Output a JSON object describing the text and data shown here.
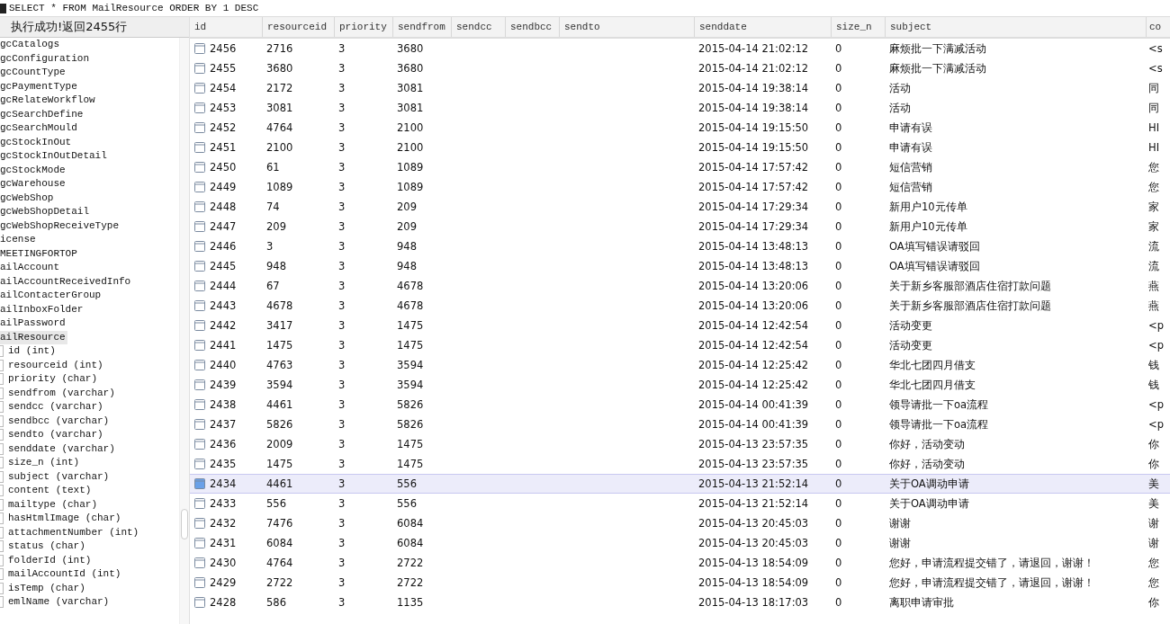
{
  "query_bar": {
    "text": "SELECT * FROM MailResource ORDER BY 1 DESC"
  },
  "sidebar": {
    "status": "执行成功!返回2455行",
    "items": [
      {
        "label": "gcCatalogs",
        "selected": false
      },
      {
        "label": "gcConfiguration",
        "selected": false
      },
      {
        "label": "gcCountType",
        "selected": false
      },
      {
        "label": "gcPaymentType",
        "selected": false
      },
      {
        "label": "gcRelateWorkflow",
        "selected": false
      },
      {
        "label": "gcSearchDefine",
        "selected": false
      },
      {
        "label": "gcSearchMould",
        "selected": false
      },
      {
        "label": "gcStockInOut",
        "selected": false
      },
      {
        "label": "gcStockInOutDetail",
        "selected": false
      },
      {
        "label": "gcStockMode",
        "selected": false
      },
      {
        "label": "gcWarehouse",
        "selected": false
      },
      {
        "label": "gcWebShop",
        "selected": false
      },
      {
        "label": "gcWebShopDetail",
        "selected": false
      },
      {
        "label": "gcWebShopReceiveType",
        "selected": false
      },
      {
        "label": "icense",
        "selected": false
      },
      {
        "label": "MEETINGFORTOP",
        "selected": false
      },
      {
        "label": "ailAccount",
        "selected": false
      },
      {
        "label": "ailAccountReceivedInfo",
        "selected": false
      },
      {
        "label": "ailContacterGroup",
        "selected": false
      },
      {
        "label": "ailInboxFolder",
        "selected": false
      },
      {
        "label": "ailPassword",
        "selected": false
      },
      {
        "label": "ailResource",
        "selected": true,
        "children": [
          {
            "label": "id (int)"
          },
          {
            "label": "resourceid (int)"
          },
          {
            "label": "priority (char)"
          },
          {
            "label": "sendfrom (varchar)"
          },
          {
            "label": "sendcc (varchar)"
          },
          {
            "label": "sendbcc (varchar)"
          },
          {
            "label": "sendto (varchar)"
          },
          {
            "label": "senddate (varchar)"
          },
          {
            "label": "size_n (int)"
          },
          {
            "label": "subject (varchar)"
          },
          {
            "label": "content (text)"
          },
          {
            "label": "mailtype (char)"
          },
          {
            "label": "hasHtmlImage (char)"
          },
          {
            "label": "attachmentNumber (int)"
          },
          {
            "label": "status (char)"
          },
          {
            "label": "folderId (int)"
          },
          {
            "label": "mailAccountId (int)"
          },
          {
            "label": "isTemp (char)"
          },
          {
            "label": "emlName (varchar)"
          }
        ]
      }
    ]
  },
  "table": {
    "columns": [
      "id",
      "resourceid",
      "priority",
      "sendfrom",
      "sendcc",
      "sendbcc",
      "sendto",
      "senddate",
      "size_n",
      "subject",
      "co"
    ],
    "rows": [
      {
        "id": "2456",
        "resourceid": "2716",
        "priority": "3",
        "sendfrom": "3680",
        "senddate": "2015-04-14 21:02:12",
        "size_n": "0",
        "subject": "麻烦批一下满减活动",
        "content": "<s",
        "selected": false
      },
      {
        "id": "2455",
        "resourceid": "3680",
        "priority": "3",
        "sendfrom": "3680",
        "senddate": "2015-04-14 21:02:12",
        "size_n": "0",
        "subject": "麻烦批一下满减活动",
        "content": "<s",
        "selected": false
      },
      {
        "id": "2454",
        "resourceid": "2172",
        "priority": "3",
        "sendfrom": "3081",
        "senddate": "2015-04-14 19:38:14",
        "size_n": "0",
        "subject": "活动",
        "content": "同",
        "selected": false
      },
      {
        "id": "2453",
        "resourceid": "3081",
        "priority": "3",
        "sendfrom": "3081",
        "senddate": "2015-04-14 19:38:14",
        "size_n": "0",
        "subject": "活动",
        "content": "同",
        "selected": false
      },
      {
        "id": "2452",
        "resourceid": "4764",
        "priority": "3",
        "sendfrom": "2100",
        "senddate": "2015-04-14 19:15:50",
        "size_n": "0",
        "subject": "申请有误",
        "content": "HI",
        "selected": false
      },
      {
        "id": "2451",
        "resourceid": "2100",
        "priority": "3",
        "sendfrom": "2100",
        "senddate": "2015-04-14 19:15:50",
        "size_n": "0",
        "subject": "申请有误",
        "content": "HI",
        "selected": false
      },
      {
        "id": "2450",
        "resourceid": "61",
        "priority": "3",
        "sendfrom": "1089",
        "senddate": "2015-04-14 17:57:42",
        "size_n": "0",
        "subject": "短信营销",
        "content": "您",
        "selected": false
      },
      {
        "id": "2449",
        "resourceid": "1089",
        "priority": "3",
        "sendfrom": "1089",
        "senddate": "2015-04-14 17:57:42",
        "size_n": "0",
        "subject": "短信营销",
        "content": "您",
        "selected": false
      },
      {
        "id": "2448",
        "resourceid": "74",
        "priority": "3",
        "sendfrom": "209",
        "senddate": "2015-04-14 17:29:34",
        "size_n": "0",
        "subject": "新用户10元传单",
        "content": "家",
        "selected": false
      },
      {
        "id": "2447",
        "resourceid": "209",
        "priority": "3",
        "sendfrom": "209",
        "senddate": "2015-04-14 17:29:34",
        "size_n": "0",
        "subject": "新用户10元传单",
        "content": "家",
        "selected": false
      },
      {
        "id": "2446",
        "resourceid": "3",
        "priority": "3",
        "sendfrom": "948",
        "senddate": "2015-04-14 13:48:13",
        "size_n": "0",
        "subject": "OA填写错误请驳回",
        "content": "流",
        "selected": false
      },
      {
        "id": "2445",
        "resourceid": "948",
        "priority": "3",
        "sendfrom": "948",
        "senddate": "2015-04-14 13:48:13",
        "size_n": "0",
        "subject": "OA填写错误请驳回",
        "content": "流",
        "selected": false
      },
      {
        "id": "2444",
        "resourceid": "67",
        "priority": "3",
        "sendfrom": "4678",
        "senddate": "2015-04-14 13:20:06",
        "size_n": "0",
        "subject": "关于新乡客服部酒店住宿打款问题",
        "content": "燕",
        "selected": false
      },
      {
        "id": "2443",
        "resourceid": "4678",
        "priority": "3",
        "sendfrom": "4678",
        "senddate": "2015-04-14 13:20:06",
        "size_n": "0",
        "subject": "关于新乡客服部酒店住宿打款问题",
        "content": "燕",
        "selected": false
      },
      {
        "id": "2442",
        "resourceid": "3417",
        "priority": "3",
        "sendfrom": "1475",
        "senddate": "2015-04-14 12:42:54",
        "size_n": "0",
        "subject": "活动变更",
        "content": "<p",
        "selected": false
      },
      {
        "id": "2441",
        "resourceid": "1475",
        "priority": "3",
        "sendfrom": "1475",
        "senddate": "2015-04-14 12:42:54",
        "size_n": "0",
        "subject": "活动变更",
        "content": "<p",
        "selected": false
      },
      {
        "id": "2440",
        "resourceid": "4763",
        "priority": "3",
        "sendfrom": "3594",
        "senddate": "2015-04-14 12:25:42",
        "size_n": "0",
        "subject": "华北七团四月借支",
        "content": "钱",
        "selected": false
      },
      {
        "id": "2439",
        "resourceid": "3594",
        "priority": "3",
        "sendfrom": "3594",
        "senddate": "2015-04-14 12:25:42",
        "size_n": "0",
        "subject": "华北七团四月借支",
        "content": "钱",
        "selected": false
      },
      {
        "id": "2438",
        "resourceid": "4461",
        "priority": "3",
        "sendfrom": "5826",
        "senddate": "2015-04-14 00:41:39",
        "size_n": "0",
        "subject": "领导请批一下oa流程",
        "content": "<p",
        "selected": false
      },
      {
        "id": "2437",
        "resourceid": "5826",
        "priority": "3",
        "sendfrom": "5826",
        "senddate": "2015-04-14 00:41:39",
        "size_n": "0",
        "subject": "领导请批一下oa流程",
        "content": "<p",
        "selected": false
      },
      {
        "id": "2436",
        "resourceid": "2009",
        "priority": "3",
        "sendfrom": "1475",
        "senddate": "2015-04-13 23:57:35",
        "size_n": "0",
        "subject": "你好，活动变动",
        "content": "你",
        "selected": false
      },
      {
        "id": "2435",
        "resourceid": "1475",
        "priority": "3",
        "sendfrom": "1475",
        "senddate": "2015-04-13 23:57:35",
        "size_n": "0",
        "subject": "你好，活动变动",
        "content": "你",
        "selected": false
      },
      {
        "id": "2434",
        "resourceid": "4461",
        "priority": "3",
        "sendfrom": "556",
        "senddate": "2015-04-13 21:52:14",
        "size_n": "0",
        "subject": "关于OA调动申请",
        "content": "美",
        "selected": true
      },
      {
        "id": "2433",
        "resourceid": "556",
        "priority": "3",
        "sendfrom": "556",
        "senddate": "2015-04-13 21:52:14",
        "size_n": "0",
        "subject": "关于OA调动申请",
        "content": "美",
        "selected": false
      },
      {
        "id": "2432",
        "resourceid": "7476",
        "priority": "3",
        "sendfrom": "6084",
        "senddate": "2015-04-13 20:45:03",
        "size_n": "0",
        "subject": "谢谢",
        "content": "谢",
        "selected": false
      },
      {
        "id": "2431",
        "resourceid": "6084",
        "priority": "3",
        "sendfrom": "6084",
        "senddate": "2015-04-13 20:45:03",
        "size_n": "0",
        "subject": "谢谢",
        "content": "谢",
        "selected": false
      },
      {
        "id": "2430",
        "resourceid": "4764",
        "priority": "3",
        "sendfrom": "2722",
        "senddate": "2015-04-13 18:54:09",
        "size_n": "0",
        "subject": "您好，申请流程提交错了，请退回，谢谢！",
        "content": "您",
        "selected": false
      },
      {
        "id": "2429",
        "resourceid": "2722",
        "priority": "3",
        "sendfrom": "2722",
        "senddate": "2015-04-13 18:54:09",
        "size_n": "0",
        "subject": "您好，申请流程提交错了，请退回，谢谢！",
        "content": "您",
        "selected": false
      },
      {
        "id": "2428",
        "resourceid": "586",
        "priority": "3",
        "sendfrom": "1135",
        "senddate": "2015-04-13 18:17:03",
        "size_n": "0",
        "subject": "离职申请审批",
        "content": "你",
        "selected": false
      }
    ]
  }
}
